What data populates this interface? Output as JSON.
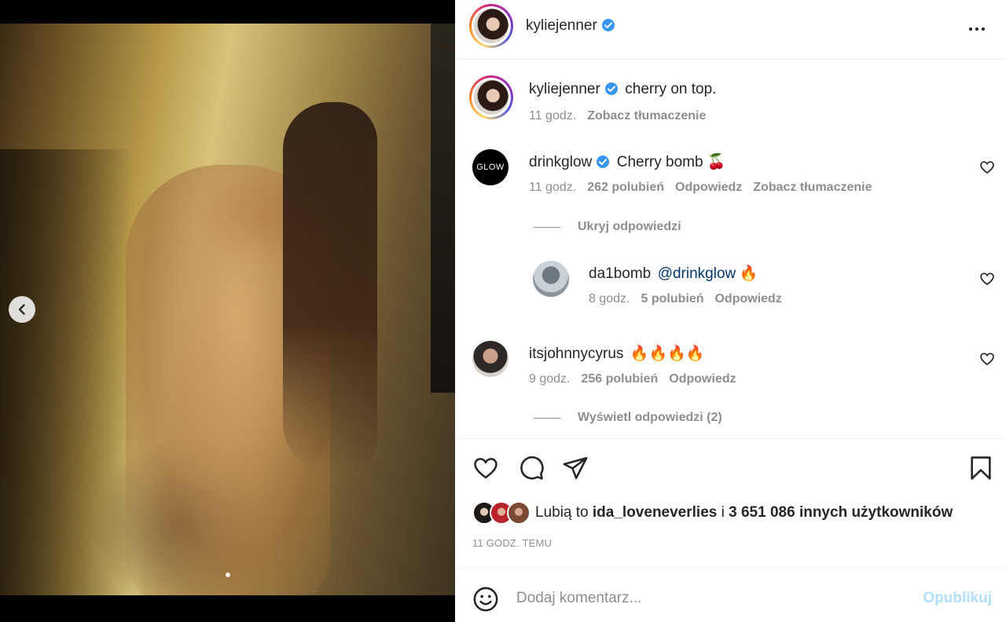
{
  "post": {
    "username": "kyliejenner",
    "caption_username": "kyliejenner",
    "caption_text": "cherry on top.",
    "caption_time": "11 godz.",
    "caption_translate": "Zobacz tłumaczenie"
  },
  "comments": [
    {
      "username": "drinkglow",
      "avatar_text": "GLOW",
      "text": "Cherry bomb 🍒",
      "time": "11 godz.",
      "likes": "262 polubień",
      "reply": "Odpowiedz",
      "translate": "Zobacz tłumaczenie",
      "toggle": "Ukryj odpowiedzi"
    },
    {
      "username": "da1bomb",
      "mention": "@drinkglow",
      "text": "🔥",
      "time": "8 godz.",
      "likes": "5 polubień",
      "reply": "Odpowiedz"
    },
    {
      "username": "itsjohnnycyrus",
      "text": "🔥🔥🔥🔥",
      "time": "9 godz.",
      "likes": "256 polubień",
      "reply": "Odpowiedz",
      "toggle": "Wyświetl odpowiedzi (2)"
    }
  ],
  "likes_line": {
    "prefix": "Lubią to",
    "user": "ida_loveneverlies",
    "mid": "i",
    "count": "3 651 086 innych użytkowników"
  },
  "time_ago": "11 GODZ. TEMU",
  "add_comment": {
    "placeholder": "Dodaj komentarz...",
    "post_label": "Opublikuj"
  },
  "colors": {
    "verified": "#3897f0",
    "link_disabled": "#b2dffc",
    "secondary_text": "#8e8e8e"
  }
}
